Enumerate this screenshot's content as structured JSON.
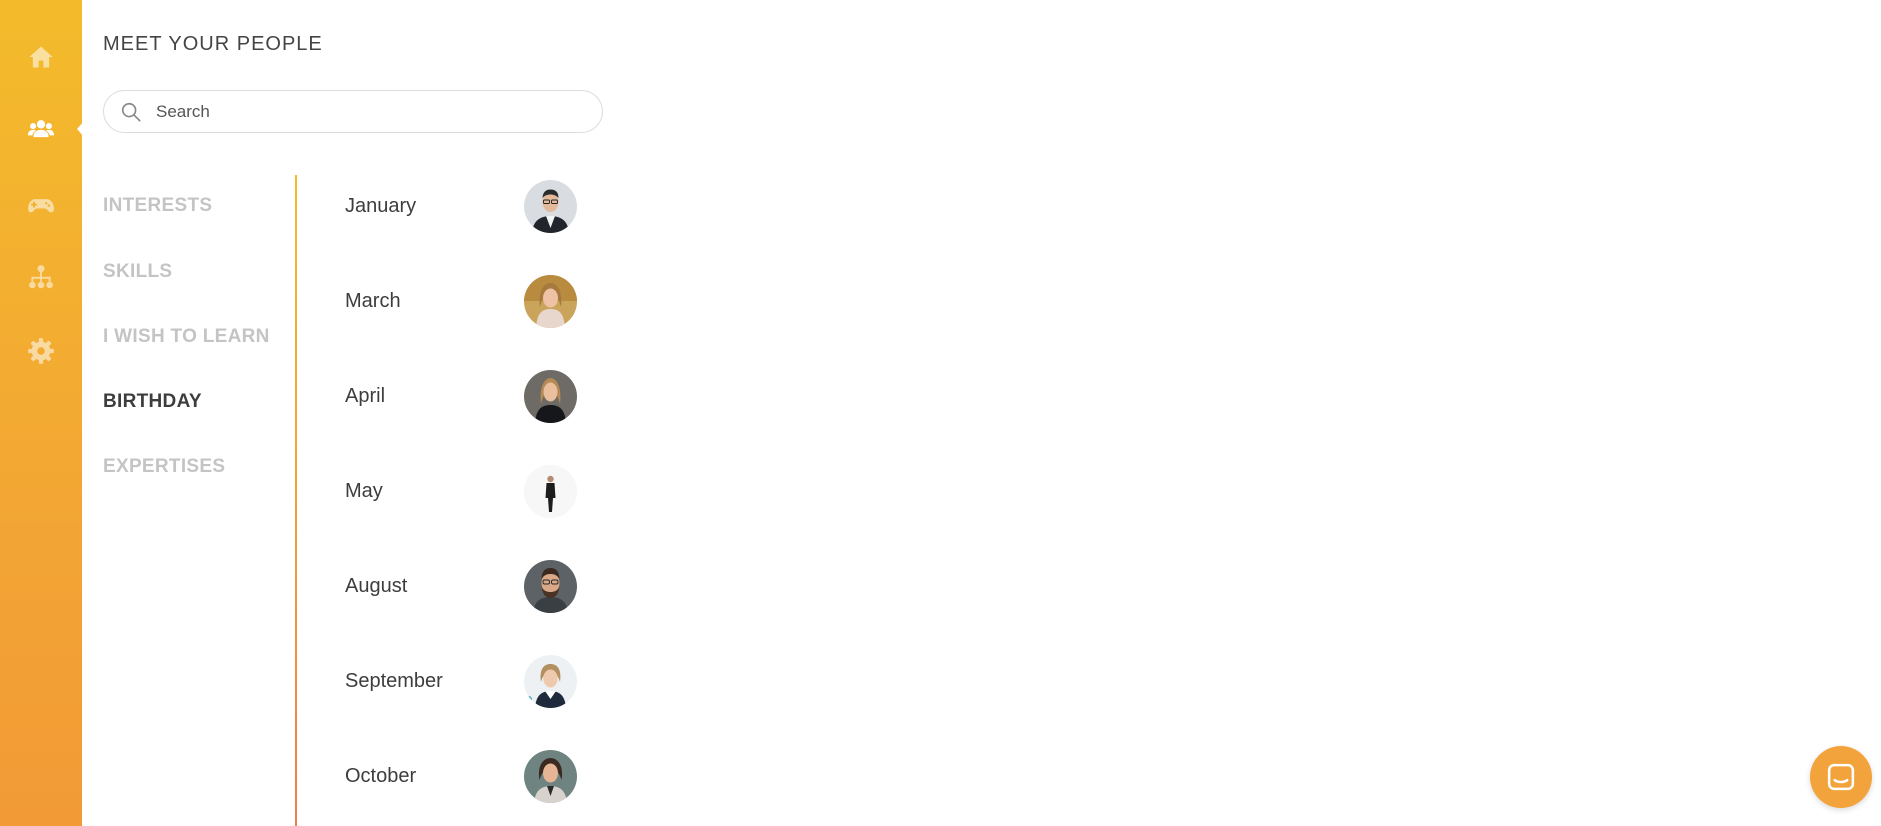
{
  "sidebar": {
    "items": [
      {
        "icon": "home-icon",
        "state": "inactive"
      },
      {
        "icon": "people-icon",
        "state": "active"
      },
      {
        "icon": "gamepad-icon",
        "state": "inactive"
      },
      {
        "icon": "org-chart-icon",
        "state": "inactive"
      },
      {
        "icon": "gear-icon",
        "state": "inactive"
      }
    ],
    "gradient": [
      "#f3bb2b",
      "#f19a36"
    ]
  },
  "page": {
    "title": "MEET YOUR PEOPLE"
  },
  "search": {
    "placeholder": "Search",
    "value": ""
  },
  "categories": [
    {
      "label": "INTERESTS",
      "active": false
    },
    {
      "label": "SKILLS",
      "active": false
    },
    {
      "label": "I WISH TO LEARN",
      "active": false
    },
    {
      "label": "BIRTHDAY",
      "active": true
    },
    {
      "label": "EXPERTISES",
      "active": false
    }
  ],
  "birthdays": [
    {
      "month": "January",
      "avatar": "avatar-man-glasses"
    },
    {
      "month": "March",
      "avatar": "avatar-woman-blonde"
    },
    {
      "month": "April",
      "avatar": "avatar-woman-dark-top"
    },
    {
      "month": "May",
      "avatar": "avatar-person-standing"
    },
    {
      "month": "August",
      "avatar": "avatar-man-beard"
    },
    {
      "month": "September",
      "avatar": "avatar-woman-short-hair"
    },
    {
      "month": "October",
      "avatar": "avatar-woman-curly"
    }
  ],
  "chat": {
    "icon": "chat-icon",
    "color": "#f3a33b"
  }
}
